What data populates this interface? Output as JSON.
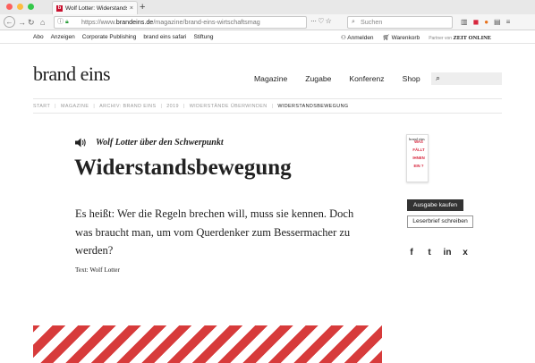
{
  "browser": {
    "tab_title": "Wolf Lotter: Widerstandsbewegu",
    "tab_favicon": "b",
    "tab_close": "×",
    "new_tab": "+",
    "url_prefix": "https://www.",
    "url_host": "brandeins.de",
    "url_path": "/magazine/brand-eins-wirtschaftsmag",
    "url_extra": "··· ♡ ☆",
    "search_placeholder": "Suchen",
    "traffic_lights": [
      "#fc605c",
      "#fdbc40",
      "#34c84a"
    ]
  },
  "meta": {
    "links": [
      "Abo",
      "Anzeigen",
      "Corporate Publishing",
      "brand eins safari",
      "Stiftung"
    ],
    "login": "Anmelden",
    "cart": "Warenkorb",
    "partner_label": "Partner von",
    "partner_name": "ZEIT ONLINE"
  },
  "header": {
    "logo": "brand eins",
    "nav": [
      "Magazine",
      "Zugabe",
      "Konferenz",
      "Shop"
    ]
  },
  "breadcrumb": [
    "START",
    "MAGAZINE",
    "ARCHIV: BRAND EINS",
    "2019",
    "WIDERSTÄNDE ÜBERWINDEN",
    "WIDERSTANDSBEWEGUNG"
  ],
  "article": {
    "kicker": "Wolf Lotter über den Schwerpunkt",
    "headline": "Widerstandsbewegung",
    "lead": "Es heißt: Wer die Regeln brechen will, muss sie kennen. Doch was braucht man, um vom Querdenker zum Bessermacher zu werden?",
    "author": "Text: Wolf Lotter"
  },
  "sidebar": {
    "cover_logo": "brand eins",
    "cover_text": "WAS FÄLLT IHNEN EIN ?",
    "buy_label": "Ausgabe kaufen",
    "letter_label": "Leserbrief schreiben",
    "share": [
      "f",
      "t",
      "in",
      "x"
    ]
  },
  "colors": {
    "stripe_red": "#d73b3b",
    "accent_red": "#d7263d",
    "button_dark": "#333333"
  }
}
